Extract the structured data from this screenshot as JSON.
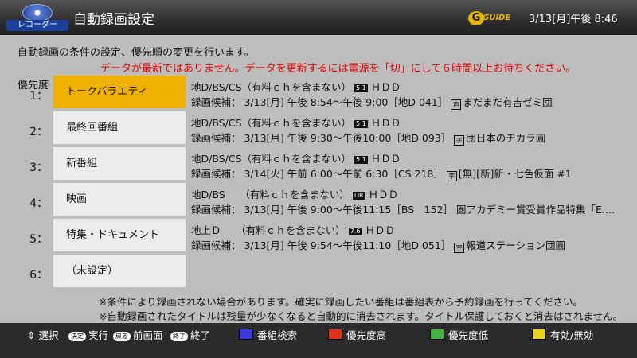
{
  "header": {
    "logo_label": "レコーダー",
    "title": "自動録画設定",
    "guide_logo_letter": "G",
    "guide_logo_text": "GUIDE",
    "datetime": "3/13[月]午後 8:46"
  },
  "description": "自動録画の条件の設定、優先順の変更を行います。",
  "warning": "データが最新ではありません。データを更新するには電源を「切」にして６時間以上お待ちください。",
  "priority_header": "優先度",
  "rows": [
    {
      "number": "1：",
      "label": "トークバラエティ",
      "selected": true,
      "line1_pre": "地D/BS/CS（有料ｃｈを含まない）",
      "line1_badge": "5.1",
      "line1_post": "ＨＤＤ",
      "line2_pre": "録画候補： 3/13[月] 午後 8:54～午後 9:00［地D 041］",
      "line2_icon": "声",
      "line2_post": "まだまだ有吉ゼミ団"
    },
    {
      "number": "2：",
      "label": "最終回番組",
      "selected": false,
      "line1_pre": "地D/BS/CS（有料ｃｈを含まない）",
      "line1_badge": "5.1",
      "line1_post": "ＨＤＤ",
      "line2_pre": "録画候補： 3/13[月] 午後 9:30～午後10:00［地D 093］",
      "line2_icon": "字",
      "line2_post": "団日本のチカラ圓"
    },
    {
      "number": "3：",
      "label": "新番組",
      "selected": false,
      "line1_pre": "地D/BS/CS（有料ｃｈを含まない）",
      "line1_badge": "5.1",
      "line1_post": "ＨＤＤ",
      "line2_pre": "録画候補： 3/14[火] 午前 6:00～午前 6:30［CS 218］",
      "line2_icon": "字",
      "line2_post": "[無][新]新・七色仮面 #1"
    },
    {
      "number": "4：",
      "label": "映画",
      "selected": false,
      "line1_pre": "地D/BS　　（有料ｃｈを含まない）",
      "line1_badge": "DR",
      "line1_post": "ＨＤＤ",
      "line2_pre": "録画候補： 3/13[月] 午後 9:00～午後11:15［BS　152］",
      "line2_icon": "",
      "line2_post": "圏アカデミー賞受賞作品特集「E.…"
    },
    {
      "number": "5：",
      "label": "特集・ドキュメント",
      "selected": false,
      "line1_pre": "地上Ｄ　　（有料ｃｈを含まない）",
      "line1_badge": "7.6",
      "line1_post": "ＨＤＤ",
      "line2_pre": "録画候補： 3/13[月] 午後 9:54～午後11:10［地D 051］",
      "line2_icon": "字",
      "line2_post": "報道ステーション団圓"
    },
    {
      "number": "6：",
      "label": "（未設定）",
      "selected": false,
      "line1_pre": "",
      "line1_badge": "",
      "line1_post": "",
      "line2_pre": "",
      "line2_icon": "",
      "line2_post": ""
    }
  ],
  "notes": [
    "※条件により録画されない場合があります。確実に録画したい番組は番組表から予約録画を行ってください。",
    "※自動録画されたタイトルは残量が少なくなると自動的に消去されます。タイトル保護しておくと消去はされません。"
  ],
  "bottom_bar": {
    "select_icon": "⇕",
    "select_label": "選択",
    "exec_key": "決定",
    "exec_label": "実行",
    "back_key": "戻る",
    "back_label": "前画面",
    "end_key": "終了",
    "end_label": "終了",
    "blue_key": "青",
    "blue_label": "番組検索",
    "red_key": "赤",
    "red_label": "優先度高",
    "green_key": "緑",
    "green_label": "優先度低",
    "yellow_key": "黄",
    "yellow_label": "有効/無効",
    "colors": {
      "blue": "#3a3adf",
      "red": "#e0321a",
      "green": "#3fb43f",
      "yellow": "#e8d21a"
    }
  }
}
